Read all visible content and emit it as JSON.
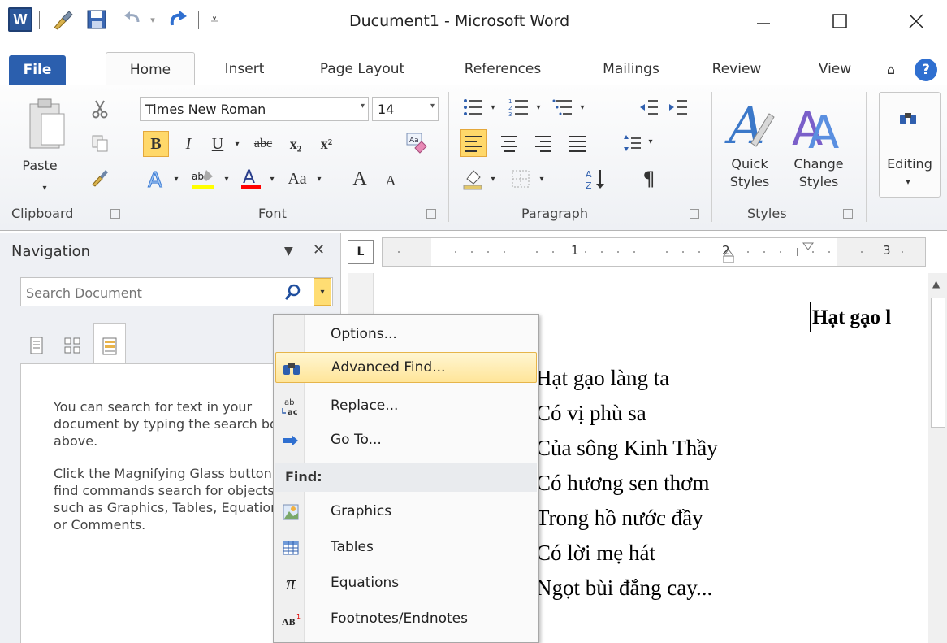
{
  "window": {
    "title": "Ducument1 - Microsoft Word",
    "logo_letter": "W"
  },
  "tabs": [
    {
      "label": "File"
    },
    {
      "label": "Home"
    },
    {
      "label": "Insert"
    },
    {
      "label": "Page Layout"
    },
    {
      "label": "References"
    },
    {
      "label": "Mailings"
    },
    {
      "label": "Review"
    },
    {
      "label": "View"
    }
  ],
  "ribbon": {
    "clipboard": {
      "label": "Clipboard",
      "paste_label": "Paste"
    },
    "font": {
      "label": "Font",
      "font_name": "Times New Roman",
      "font_size": "14",
      "bold": "B",
      "italic": "I",
      "underline": "U",
      "strike": "abc",
      "subscript": "x₂",
      "superscript": "x²",
      "change_case": "Aa",
      "grow": "A",
      "shrink": "A"
    },
    "paragraph": {
      "label": "Paragraph",
      "pilcrow": "¶"
    },
    "styles": {
      "label": "Styles",
      "quick_styles": "Quick Styles",
      "change_styles": "Change Styles"
    },
    "editing": {
      "label": "Editing"
    }
  },
  "navigation": {
    "title": "Navigation",
    "search_placeholder": "Search Document",
    "help_text_1": "You can search for text in your document by typing the search box above.",
    "help_text_2": "Click the Magnifying Glass button to find commands search for objects, such as Graphics, Tables, Equation or Comments."
  },
  "ruler": {
    "mark_1": "1",
    "mark_2": "2",
    "mark_3": "3"
  },
  "document": {
    "heading": "Hạt gạo l",
    "lines": [
      "Hạt gạo làng ta",
      "Có vị phù sa",
      "Của sông Kinh Thầy",
      "Có hương sen thơm",
      "Trong hồ nước đầy",
      "Có lời mẹ hát",
      "Ngọt bùi đắng cay..."
    ]
  },
  "search_menu": {
    "items": [
      {
        "label": "Options..."
      },
      {
        "label": "Advanced Find..."
      },
      {
        "label": "Replace..."
      },
      {
        "label": "Go To..."
      }
    ],
    "find_header": "Find:",
    "find_items": [
      {
        "label": "Graphics"
      },
      {
        "label": "Tables"
      },
      {
        "label": "Equations"
      },
      {
        "label": "Footnotes/Endnotes"
      }
    ]
  }
}
